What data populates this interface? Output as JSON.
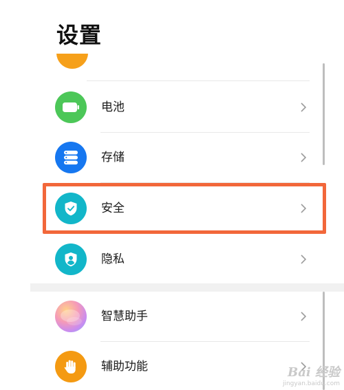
{
  "header": {
    "title": "设置"
  },
  "settings": {
    "items": [
      {
        "label": "电池",
        "icon": "battery-icon",
        "color": "#4cc758"
      },
      {
        "label": "存储",
        "icon": "storage-icon",
        "color": "#1677f0"
      },
      {
        "label": "安全",
        "icon": "shield-check-icon",
        "color": "#12b6c9"
      },
      {
        "label": "隐私",
        "icon": "privacy-user-shield-icon",
        "color": "#12b6c9"
      },
      {
        "label": "智慧助手",
        "icon": "smart-assistant-icon",
        "color": "#e77ad2"
      },
      {
        "label": "辅助功能",
        "icon": "hand-icon",
        "color": "#f49a12"
      }
    ]
  },
  "highlight": {
    "target": "安全",
    "color": "#f2673a"
  },
  "watermark": {
    "text": "Bai 经验",
    "sub": "jingyan.baidu.com"
  }
}
